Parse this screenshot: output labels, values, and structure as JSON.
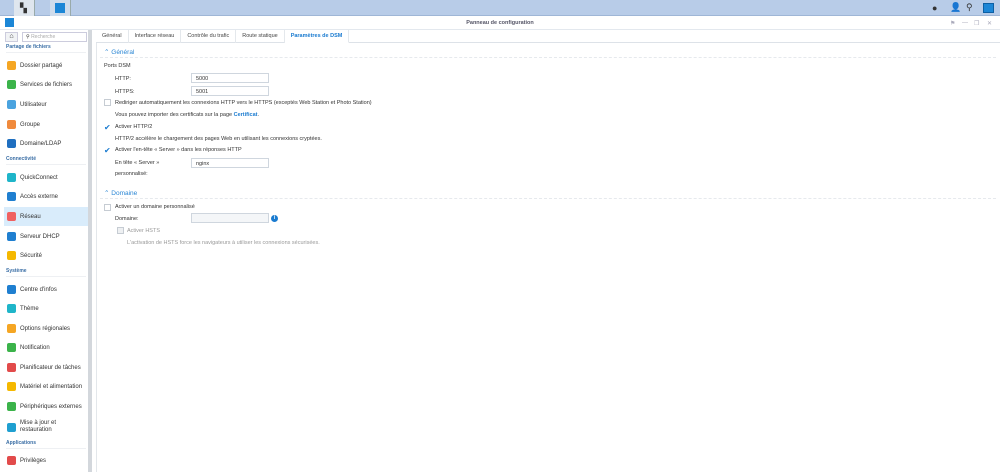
{
  "window": {
    "title": "Panneau de configuration"
  },
  "sidebar": {
    "search_placeholder": "Recherche",
    "sections": [
      {
        "label": "Partage de fichiers",
        "items": [
          "Dossier partagé",
          "Services de fichiers",
          "Utilisateur",
          "Groupe",
          "Domaine/LDAP"
        ]
      },
      {
        "label": "Connectivité",
        "items": [
          "QuickConnect",
          "Accès externe",
          "Réseau",
          "Serveur DHCP",
          "Sécurité"
        ]
      },
      {
        "label": "Système",
        "items": [
          "Centre d'infos",
          "Thème",
          "Options régionales",
          "Notification",
          "Planificateur de tâches",
          "Matériel et alimentation",
          "Périphériques externes",
          "Mise à jour et restauration"
        ]
      },
      {
        "label": "Applications",
        "items": [
          "Privilèges"
        ]
      }
    ],
    "selected": "Réseau"
  },
  "tabs": [
    "Général",
    "Interface réseau",
    "Contrôle du trafic",
    "Route statique",
    "Paramètres de DSM"
  ],
  "active_tab": "Paramètres de DSM",
  "general": {
    "title": "Général",
    "ports_label": "Ports DSM",
    "http_label": "HTTP:",
    "http_value": "5000",
    "https_label": "HTTPS:",
    "https_value": "5001",
    "redirect_label": "Rediriger automatiquement les connexions HTTP vers le HTTPS (exceptés Web Station et Photo Station)",
    "cert_text": "Vous pouvez importer des certificats sur la page ",
    "cert_link": "Certificat",
    "cert_end": ".",
    "http2_label": "Activer HTTP/2",
    "http2_desc": "HTTP/2 accélère le chargement des pages Web en utilisant les connexions cryptées.",
    "server_header_label": "Activer l'en-tête « Server » dans les réponses HTTP",
    "custom_header_label_1": "En tête « Server »",
    "custom_header_label_2": "personnalisé:",
    "custom_header_value": "nginx"
  },
  "domain": {
    "title": "Domaine",
    "enable_label": "Activer un domaine personnalisé",
    "domain_label": "Domaine:",
    "domain_value": "",
    "hsts_label": "Activer HSTS",
    "hsts_desc": "L'activation de HSTS force les navigateurs à utiliser les connexions sécurisées."
  }
}
